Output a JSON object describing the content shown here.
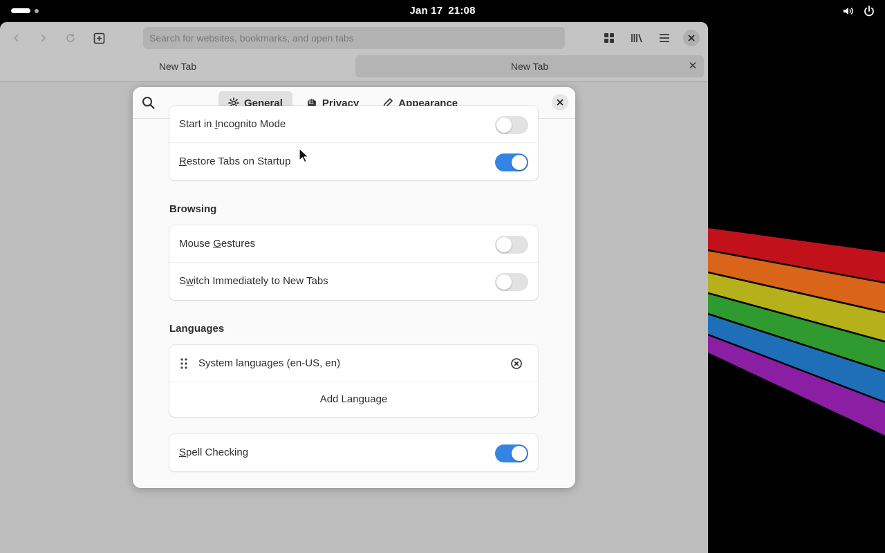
{
  "topbar": {
    "date": "Jan 17",
    "time": "21:08",
    "volume_icon": "volume-icon",
    "power_icon": "power-icon"
  },
  "browser": {
    "url_placeholder": "Search for websites, bookmarks, and open tabs",
    "tabs": [
      {
        "label": "New Tab"
      },
      {
        "label": "New Tab"
      }
    ]
  },
  "preferences": {
    "tabs": {
      "general": "General",
      "privacy": "Privacy",
      "appearance": "Appearance"
    },
    "startup": {
      "incognito": {
        "label_pre": "Start in ",
        "label_u": "I",
        "label_post": "ncognito Mode",
        "on": false
      },
      "restore": {
        "label_pre": "",
        "label_u": "R",
        "label_post": "estore Tabs on Startup",
        "on": true
      }
    },
    "browsing": {
      "title": "Browsing",
      "gestures": {
        "label_pre": "Mouse ",
        "label_u": "G",
        "label_post": "estures",
        "on": false
      },
      "switch_tabs": {
        "label_pre": "S",
        "label_u": "w",
        "label_post": "itch Immediately to New Tabs",
        "on": false
      }
    },
    "languages": {
      "title": "Languages",
      "items": [
        "System languages (en-US, en)"
      ],
      "add_label": "Add Language"
    },
    "spell": {
      "label_pre": "",
      "label_u": "S",
      "label_post": "pell Checking",
      "on": true
    }
  },
  "colors": {
    "accent": "#3584e4",
    "wallpaper_stripes": [
      "#c1121c",
      "#d9641a",
      "#b6b01a",
      "#2f9a2f",
      "#1f6fb8",
      "#8b1fa3"
    ]
  }
}
